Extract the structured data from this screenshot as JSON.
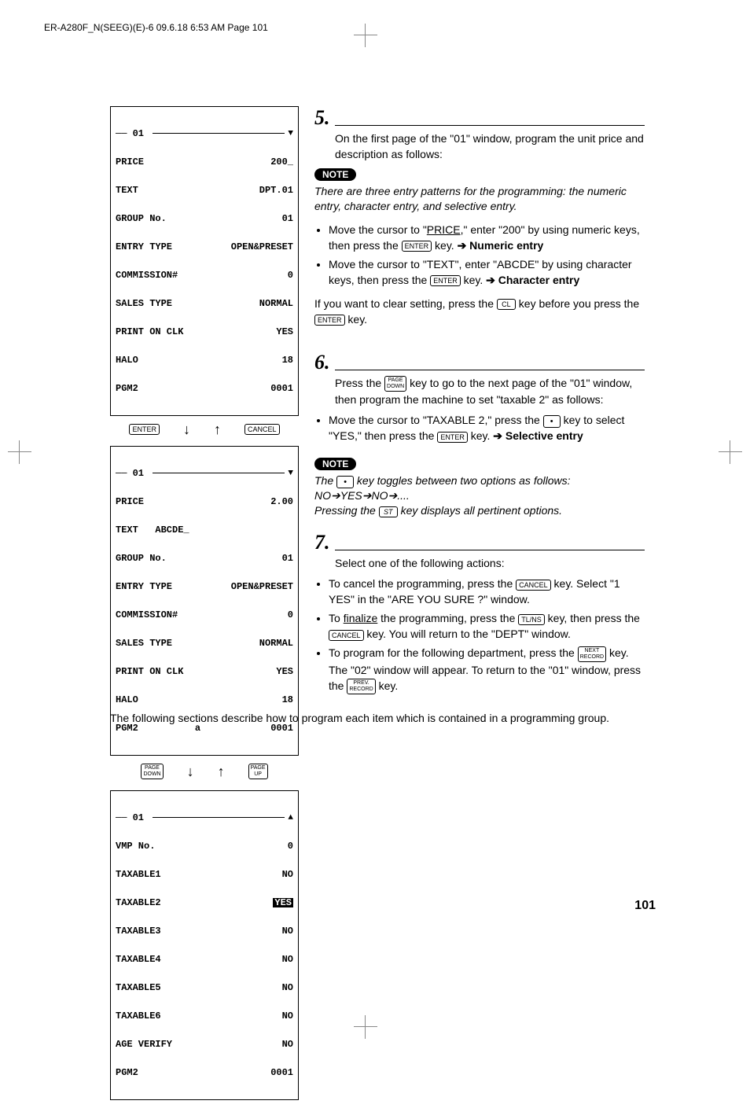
{
  "header_line": "ER-A280F_N(SEEG)(E)-6  09.6.18 6:53 AM  Page 101",
  "page_number": "101",
  "screens": {
    "s1": {
      "title": "01",
      "rows": [
        [
          "PRICE",
          "200_"
        ],
        [
          "TEXT",
          "DPT.01"
        ],
        [
          "GROUP No.",
          "01"
        ],
        [
          "ENTRY TYPE",
          "OPEN&PRESET"
        ],
        [
          "COMMISSION#",
          "0"
        ],
        [
          "SALES TYPE",
          "NORMAL"
        ],
        [
          "PRINT ON CLK",
          "YES"
        ],
        [
          "HALO",
          "18"
        ],
        [
          "PGM2",
          "0001"
        ]
      ],
      "arrow": "down"
    },
    "s2": {
      "title": "01",
      "rows": [
        [
          "PRICE",
          "2.00"
        ],
        [
          "TEXT   ABCDE_",
          ""
        ],
        [
          "GROUP No.",
          "01"
        ],
        [
          "ENTRY TYPE",
          "OPEN&PRESET"
        ],
        [
          "COMMISSION#",
          "0"
        ],
        [
          "SALES TYPE",
          "NORMAL"
        ],
        [
          "PRINT ON CLK",
          "YES"
        ],
        [
          "HALO",
          "18"
        ],
        [
          "PGM2          a",
          "0001"
        ]
      ],
      "arrow": "down"
    },
    "s3": {
      "title": "01",
      "rows": [
        [
          "VMP No.",
          "0"
        ],
        [
          "TAXABLE1",
          "NO"
        ],
        [
          "TAXABLE2",
          "YES"
        ],
        [
          "TAXABLE3",
          "NO"
        ],
        [
          "TAXABLE4",
          "NO"
        ],
        [
          "TAXABLE5",
          "NO"
        ],
        [
          "TAXABLE6",
          "NO"
        ],
        [
          "AGE VERIFY",
          "NO"
        ],
        [
          "PGM2",
          "0001"
        ]
      ],
      "arrow": "up",
      "reversed_row": 2
    }
  },
  "nav_keys": {
    "row1_left": "ENTER",
    "row1_right": "CANCEL",
    "row2_left_a": "PAGE",
    "row2_left_b": "DOWN",
    "row2_right_a": "PAGE",
    "row2_right_b": "UP"
  },
  "step5": {
    "num": "5.",
    "lead": "On the first page of the \"01\" window, program the unit price and description as follows:",
    "note_label": "NOTE",
    "note": "There are three entry patterns for the programming: the numeric entry, character entry, and selective entry.",
    "b1a": "Move the cursor to \"",
    "b1b": "PRICE",
    "b1c": ",\" enter \"200\" by using numeric keys, then press the ",
    "b1key": "ENTER",
    "b1d": " key.   ",
    "b1arrow": "➔",
    "b1bold": " Numeric entry",
    "b2a": "Move the cursor to \"TEXT\", enter \"ABCDE\" by using character keys, then press the ",
    "b2key": "ENTER",
    "b2b": " key.   ",
    "b2arrow": "➔",
    "b2bold": " Character entry",
    "tail_a": "If you want to clear setting, press the ",
    "tail_key1": "CL",
    "tail_b": " key before you press the ",
    "tail_key2": "ENTER",
    "tail_c": " key."
  },
  "step6": {
    "num": "6.",
    "lead_a": "Press the ",
    "lead_key_a": "PAGE",
    "lead_key_b": "DOWN",
    "lead_b": " key to go to the next page of the \"01\" window, then program the machine to set \"taxable 2\" as follows:",
    "b1a": "Move the cursor to \"TAXABLE 2,\" press the ",
    "b1dot": "•",
    "b1b": " key to select \"YES,\" then press the ",
    "b1key": "ENTER",
    "b1c": " key.   ",
    "b1arrow": "➔",
    "b1bold": " Selective entry",
    "note_label": "NOTE",
    "note_a": "The ",
    "note_dot": "•",
    "note_b": " key toggles between two options as follows:",
    "note_seq": "NO➔YES➔NO➔....",
    "note_c": "Pressing the ",
    "note_key": "ST",
    "note_d": " key displays all pertinent options."
  },
  "step7": {
    "num": "7.",
    "lead": "Select one of the following actions:",
    "b1a": "To cancel the programming, press the ",
    "b1key": "CANCEL",
    "b1b": " key. Select \"1 YES\" in the \"ARE YOU SURE ?\" window.",
    "b2a": "To ",
    "b2u": "finalize",
    "b2b": " the programming, press the ",
    "b2key1": "TL/NS",
    "b2c": " key, then press the ",
    "b2key2": "CANCEL",
    "b2d": " key. You will return to the \"DEPT\" window.",
    "b3a": "To program for the following department, press the ",
    "b3key1a": "NEXT",
    "b3key1b": "RECORD",
    "b3b": " key. The \"02\" window will appear. To return to the \"01\" window, press the ",
    "b3key2a": "PREV.",
    "b3key2b": "RECORD",
    "b3c": " key."
  },
  "bottom": "The following sections describe how to program each item which is contained in a programming group."
}
